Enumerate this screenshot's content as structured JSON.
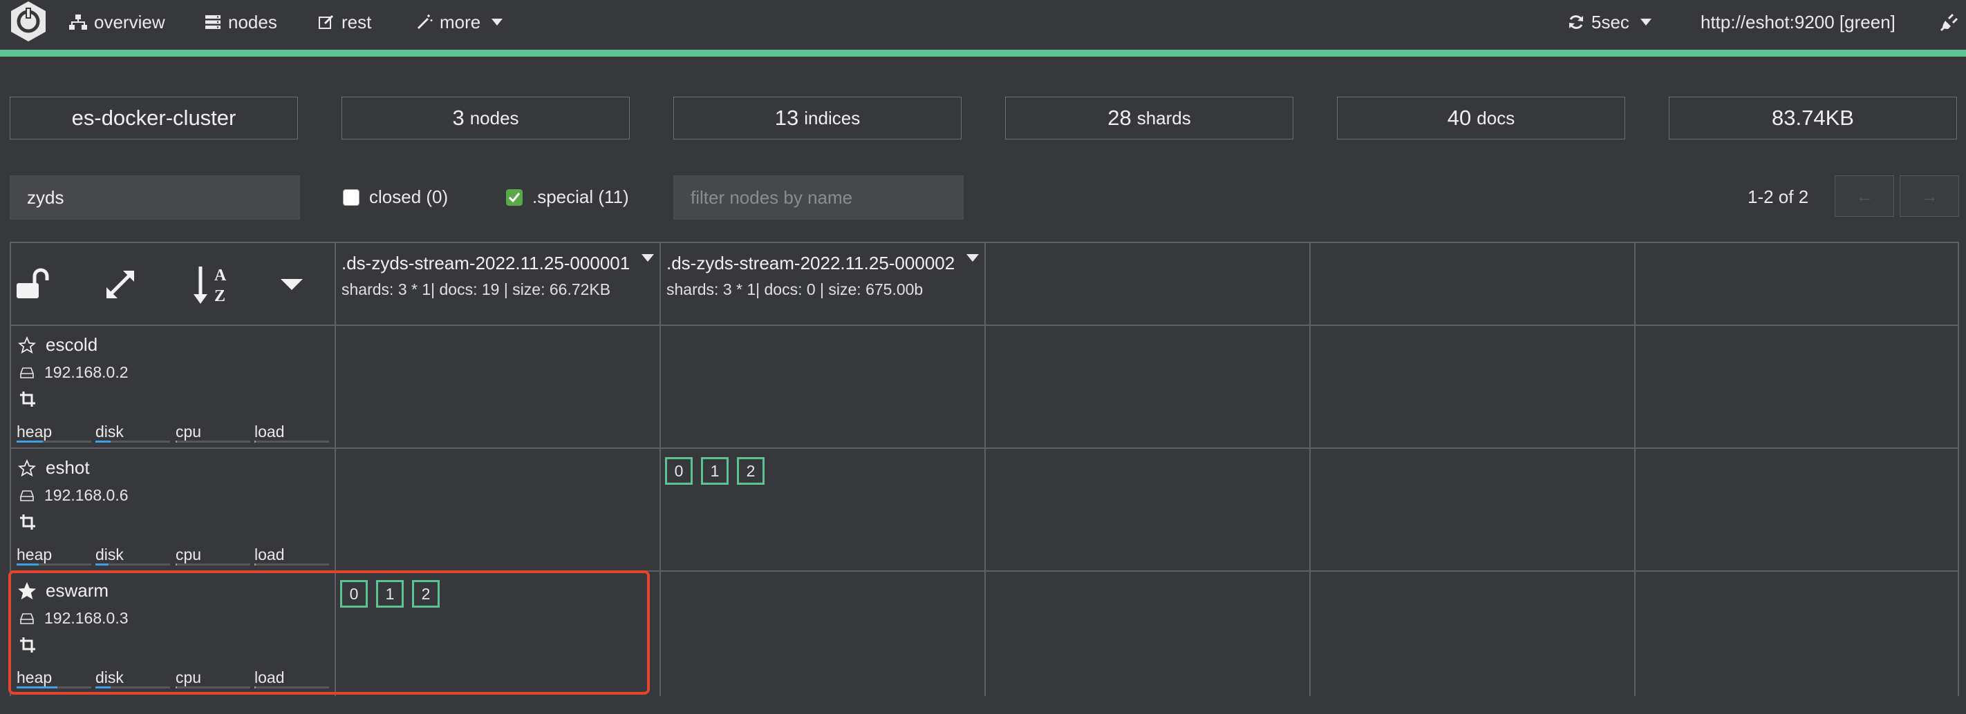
{
  "navbar": {
    "overview": "overview",
    "nodes": "nodes",
    "rest": "rest",
    "more": "more",
    "refresh": "5sec",
    "cluster_url": "http://eshot:9200 [green]",
    "status_color": "#5cc393"
  },
  "stats": {
    "cluster_name": "es-docker-cluster",
    "nodes_count": "3",
    "nodes_unit": "nodes",
    "indices_count": "13",
    "indices_unit": "indices",
    "shards_count": "28",
    "shards_unit": "shards",
    "docs_count": "40",
    "docs_unit": "docs",
    "size": "83.74KB"
  },
  "filters": {
    "index_filter_value": "zyds",
    "closed_label": "closed (0)",
    "closed_checked": false,
    "special_label": ".special (11)",
    "special_checked": true,
    "node_filter_placeholder": "filter nodes by name",
    "pagination": "1-2 of 2",
    "prev": "←",
    "next": "→"
  },
  "indices": [
    {
      "name": ".ds-zyds-stream-2022.11.25-000001",
      "info": "shards: 3 * 1| docs: 19 | size: 66.72KB"
    },
    {
      "name": ".ds-zyds-stream-2022.11.25-000002",
      "info": "shards: 3 * 1| docs: 0 | size: 675.00b"
    }
  ],
  "metric_labels": {
    "heap": "heap",
    "disk": "disk",
    "cpu": "cpu",
    "load": "load"
  },
  "nodes": [
    {
      "name": "escold",
      "ip": "192.168.0.2",
      "master": false,
      "heap": 0.35,
      "disk": 0.2,
      "cpu": 0.02,
      "load": 0.02
    },
    {
      "name": "eshot",
      "ip": "192.168.0.6",
      "master": false,
      "heap": 0.3,
      "disk": 0.18,
      "cpu": 0.02,
      "load": 0.02
    },
    {
      "name": "eswarm",
      "ip": "192.168.0.3",
      "master": true,
      "heap": 0.55,
      "disk": 0.2,
      "cpu": 0.02,
      "load": 0.02
    }
  ],
  "shards": {
    "eshot_index2": [
      "0",
      "1",
      "2"
    ],
    "eswarm_index1": [
      "0",
      "1",
      "2"
    ]
  },
  "colors": {
    "accent": "#5cc393",
    "highlight": "#e2442d",
    "meter": "#3fa0e8"
  }
}
